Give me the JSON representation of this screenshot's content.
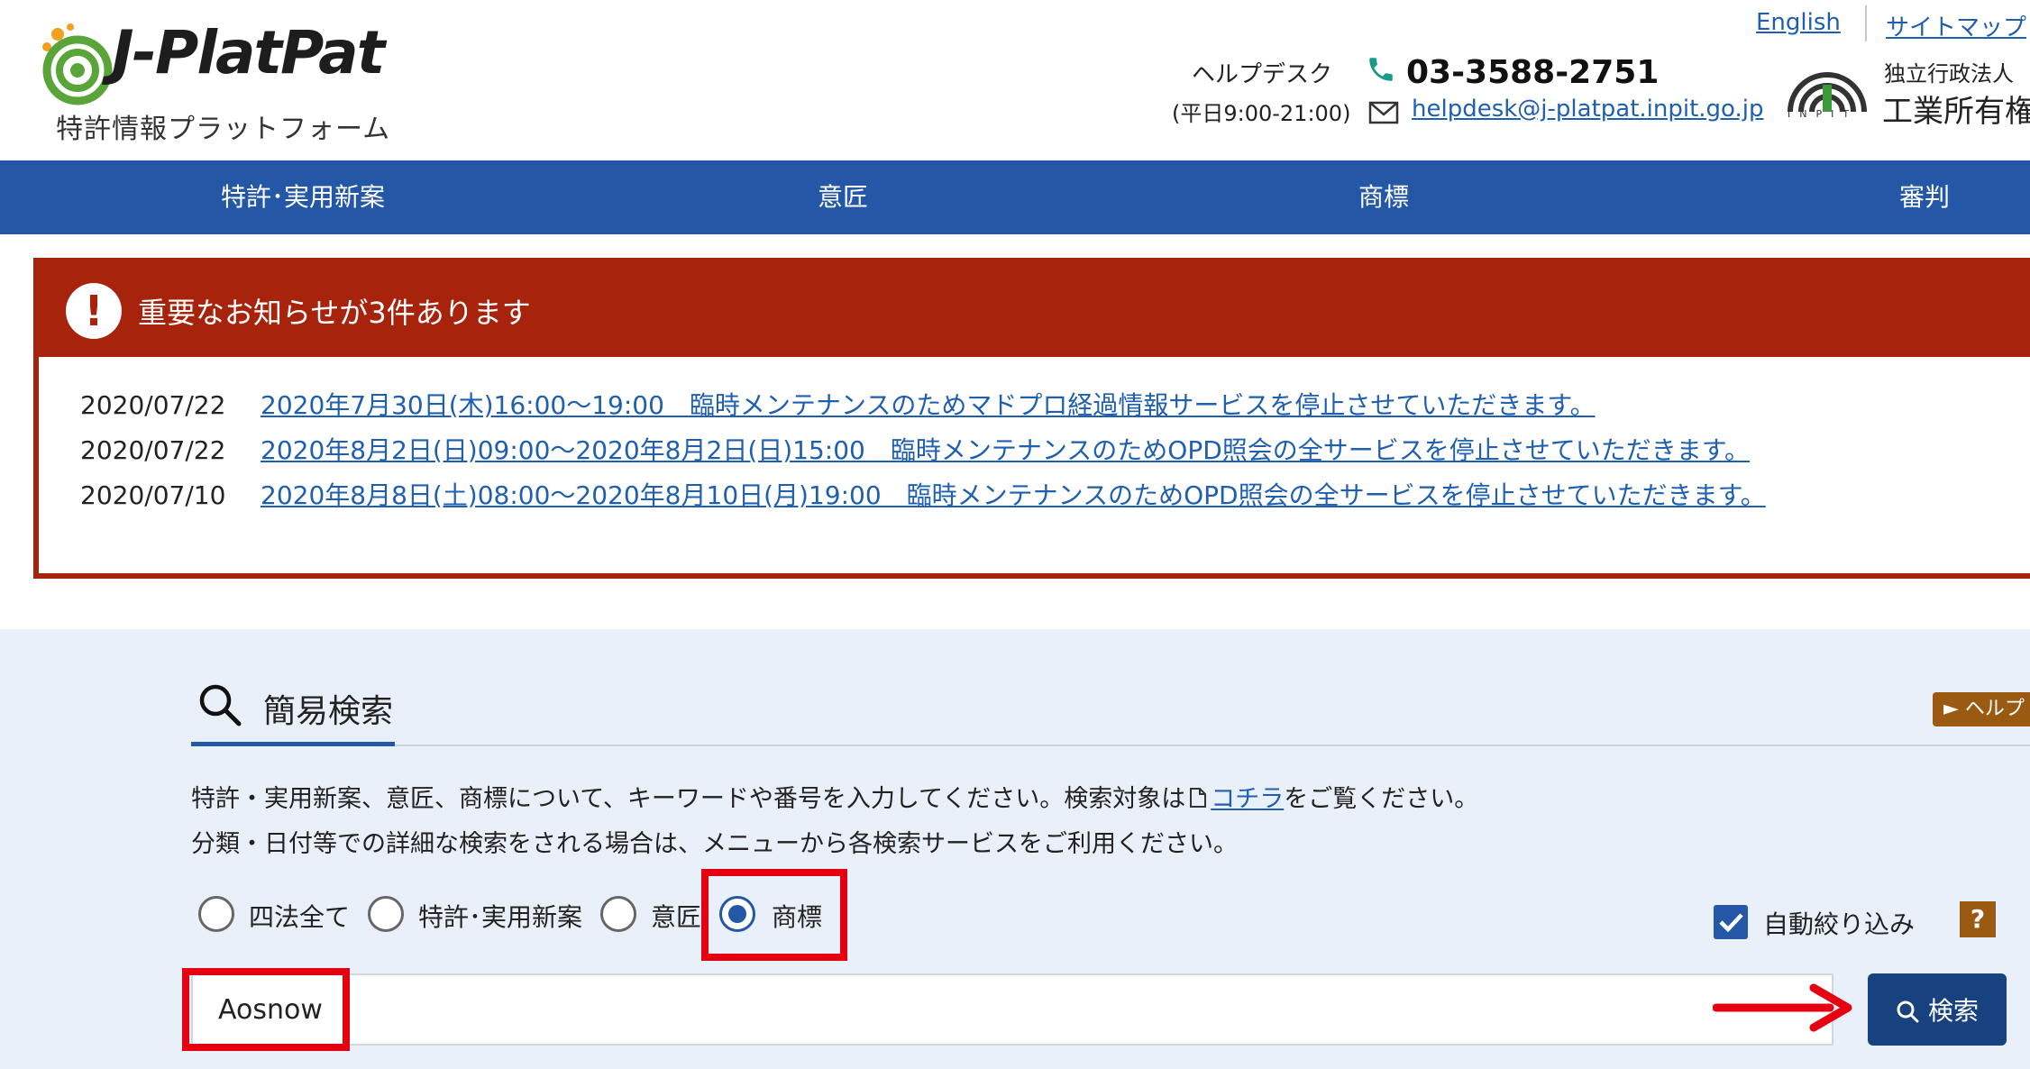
{
  "header": {
    "logo_text": "J-PlatPat",
    "logo_sub": "特許情報プラットフォーム",
    "links": {
      "english": "English",
      "sitemap": "サイトマップ"
    },
    "helpdesk": {
      "label": "ヘルプデスク",
      "hours": "(平日9:00-21:00)",
      "phone": "03-3588-2751",
      "email": "helpdesk@j-platpat.inpit.go.jp"
    },
    "org": {
      "logo_text": "INPIT",
      "small": "独立行政法人",
      "big": "工業所有権"
    }
  },
  "nav": {
    "items": [
      {
        "label": "特許･実用新案"
      },
      {
        "label": "意匠"
      },
      {
        "label": "商標"
      },
      {
        "label": "審判"
      }
    ]
  },
  "notice": {
    "title": "重要なお知らせが3件あります",
    "items": [
      {
        "date": "2020/07/22",
        "text": "2020年7月30日(木)16:00～19:00　臨時メンテナンスのためマドプロ経過情報サービスを停止させていただきます。"
      },
      {
        "date": "2020/07/22",
        "text": "2020年8月2日(日)09:00～2020年8月2日(日)15:00　臨時メンテナンスのためOPD照会の全サービスを停止させていただきます。"
      },
      {
        "date": "2020/07/10",
        "text": "2020年8月8日(土)08:00～2020年8月10日(月)19:00　臨時メンテナンスのためOPD照会の全サービスを停止させていただきます。"
      }
    ]
  },
  "search": {
    "title": "簡易検索",
    "help_label": "► ヘルプ",
    "desc1_pre": "特許・実用新案、意匠、商標について、キーワードや番号を入力してください。検索対象は",
    "desc1_link": "コチラ",
    "desc1_post": "をご覧ください。",
    "desc2": "分類・日付等での詳細な検索をされる場合は、メニューから各検索サービスをご利用ください。",
    "radios": [
      {
        "label": "四法全て",
        "checked": false
      },
      {
        "label": "特許･実用新案",
        "checked": false
      },
      {
        "label": "意匠",
        "checked": false
      },
      {
        "label": "商標",
        "checked": true
      }
    ],
    "auto_label": "自動絞り込み",
    "help_q": "?",
    "input_value": "Aosnow",
    "button_label": "検索"
  },
  "colors": {
    "nav_blue": "#2458a6",
    "notice_red": "#a8230c",
    "highlight_red": "#e50012",
    "button_navy": "#17427f"
  }
}
